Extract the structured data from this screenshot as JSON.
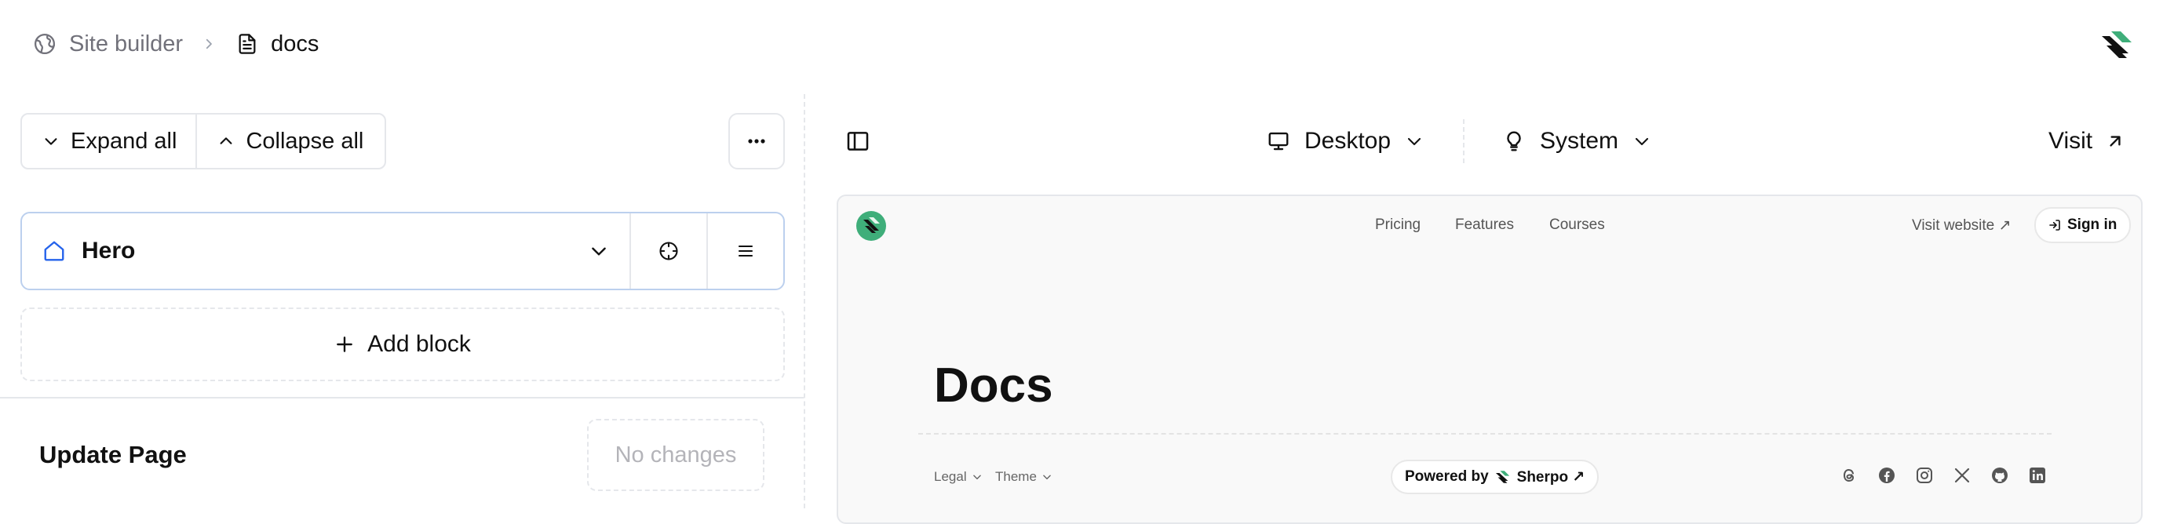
{
  "breadcrumb": {
    "root": "Site builder",
    "current": "docs"
  },
  "toolbar": {
    "expand_all": "Expand all",
    "collapse_all": "Collapse all"
  },
  "blocks": [
    {
      "label": "Hero"
    }
  ],
  "add_block": "Add block",
  "update": {
    "title": "Update Page",
    "status_button": "No changes"
  },
  "preview_toolbar": {
    "device": "Desktop",
    "theme": "System",
    "visit": "Visit"
  },
  "preview": {
    "nav": [
      "Pricing",
      "Features",
      "Courses"
    ],
    "visit_website": "Visit website ↗",
    "sign_in": "Sign in",
    "title": "Docs",
    "footer": {
      "legal": "Legal",
      "theme": "Theme",
      "powered_by": "Powered by",
      "brand": "Sherpo ↗"
    },
    "social_icons": [
      "threads-icon",
      "facebook-icon",
      "instagram-icon",
      "x-icon",
      "github-icon",
      "linkedin-icon"
    ]
  },
  "colors": {
    "accent_blue": "#2563eb",
    "hero_border": "#bcd0ee",
    "brand_green": "#3fae7a"
  }
}
